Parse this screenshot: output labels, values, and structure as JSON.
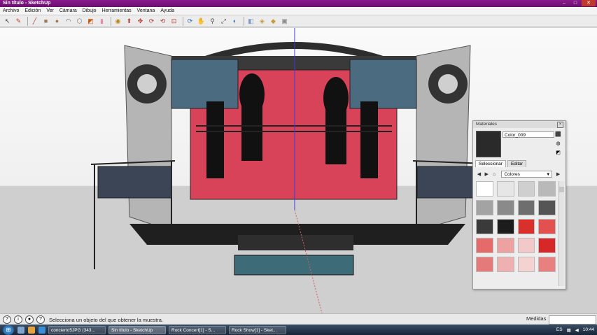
{
  "window": {
    "title": "Sin título - SketchUp"
  },
  "menu": {
    "items": [
      "Archivo",
      "Edición",
      "Ver",
      "Cámara",
      "Dibujo",
      "Herramientas",
      "Ventana",
      "Ayuda"
    ]
  },
  "toolbar": {
    "tools": [
      {
        "name": "select-tool",
        "glyph": "↖",
        "color": "#333333"
      },
      {
        "name": "eraser-tool",
        "glyph": "✎",
        "color": "#c0392b"
      },
      {
        "name": "line-tool",
        "glyph": "╱",
        "color": "#c0392b"
      },
      {
        "name": "rectangle-tool",
        "glyph": "■",
        "color": "#a07850"
      },
      {
        "name": "circle-tool",
        "glyph": "●",
        "color": "#a07850"
      },
      {
        "name": "arc-tool",
        "glyph": "◠",
        "color": "#555555"
      },
      {
        "name": "polygon-tool",
        "glyph": "⬡",
        "color": "#777777"
      },
      {
        "name": "paint-bucket-tool",
        "glyph": "◩",
        "color": "#d35400"
      },
      {
        "name": "eraser-block-tool",
        "glyph": "▮",
        "color": "#e08bb0"
      },
      {
        "name": "tape-measure-tool",
        "glyph": "◉",
        "color": "#b8860b"
      },
      {
        "name": "push-pull-tool",
        "glyph": "⬆",
        "color": "#c0392b"
      },
      {
        "name": "move-tool",
        "glyph": "✥",
        "color": "#c0392b"
      },
      {
        "name": "rotate-tool",
        "glyph": "⟳",
        "color": "#c0392b"
      },
      {
        "name": "follow-me-tool",
        "glyph": "⟲",
        "color": "#c0392b"
      },
      {
        "name": "offset-tool",
        "glyph": "⊡",
        "color": "#c0392b"
      },
      {
        "name": "orbit-tool",
        "glyph": "⟳",
        "color": "#2c6fb5"
      },
      {
        "name": "pan-tool",
        "glyph": "✋",
        "color": "#555555"
      },
      {
        "name": "zoom-tool",
        "glyph": "⚲",
        "color": "#555555"
      },
      {
        "name": "zoom-extents-tool",
        "glyph": "⤢",
        "color": "#555555"
      },
      {
        "name": "previous-view-tool",
        "glyph": "◐",
        "color": "#2c6fb5"
      },
      {
        "name": "warehouse-tool",
        "glyph": "◧",
        "color": "#7a9cc6"
      },
      {
        "name": "components-tool",
        "glyph": "◈",
        "color": "#c69a3a"
      },
      {
        "name": "share-tool",
        "glyph": "◆",
        "color": "#c69a3a"
      },
      {
        "name": "layout-tool",
        "glyph": "▣",
        "color": "#888888"
      }
    ]
  },
  "status": {
    "text": "Selecciona un objeto del que obtener la muestra.",
    "measures_label": "Medidas",
    "measures_value": ""
  },
  "materials": {
    "panel_title": "Materiales",
    "current_name": "Color_009",
    "current_color": "#2a2a2a",
    "tabs": [
      "Seleccionar",
      "Editar"
    ],
    "collection": "Colores",
    "swatches": [
      "#ffffff",
      "#e6e6e6",
      "#cfcfcf",
      "#b9b9b9",
      "#a3a3a3",
      "#8a8a8a",
      "#6e6e6e",
      "#555555",
      "#3a3a3a",
      "#1c1c1c",
      "#d9302c",
      "#e35050",
      "#e56a6a",
      "#eda1a1",
      "#f3c8c8",
      "#d62828",
      "#e57a7a",
      "#eeb0b0",
      "#f5d2d2",
      "#e98080"
    ]
  },
  "taskbar": {
    "tasks": [
      "concierto5JPG (343...",
      "Sin título - SketchUp",
      "Rock Concert[1] - S...",
      "Rock Show[1] - Sket..."
    ],
    "lang": "ES",
    "time": "10:44"
  }
}
